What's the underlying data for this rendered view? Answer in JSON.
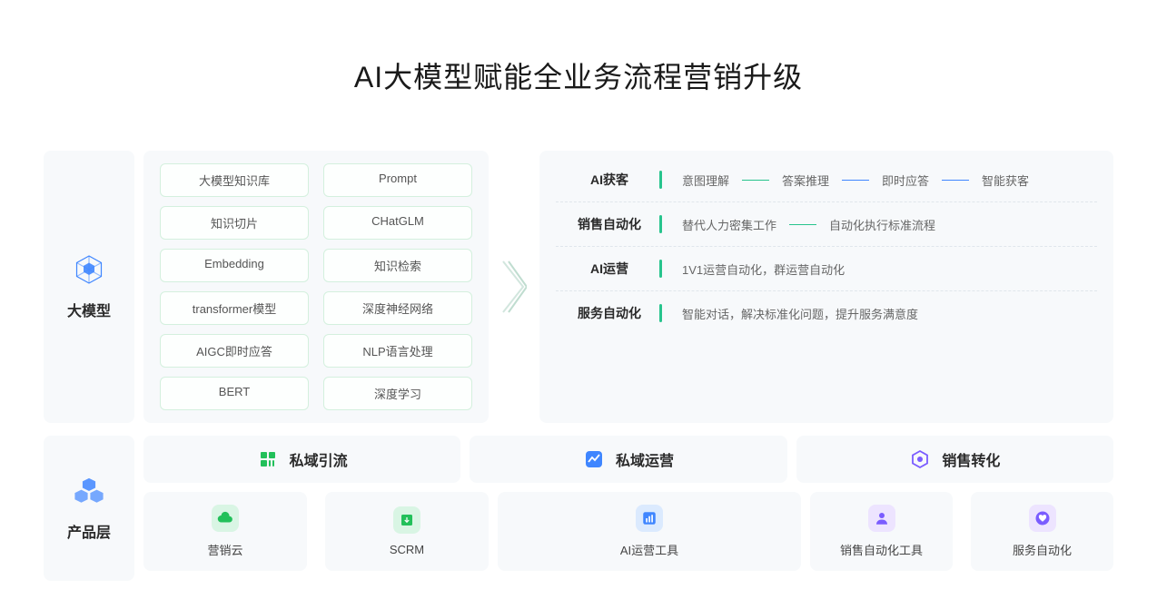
{
  "title": "AI大模型赋能全业务流程营销升级",
  "sidebar": {
    "model": "大模型",
    "product": "产品层"
  },
  "tech_tags": [
    "大模型知识库",
    "Prompt",
    "知识切片",
    "CHatGLM",
    "Embedding",
    "知识检索",
    "transformer模型",
    "深度神经网络",
    "AIGC即时应答",
    "NLP语言处理",
    "BERT",
    "深度学习"
  ],
  "capabilities": [
    {
      "title": "AI获客",
      "items": [
        "意图理解",
        "答案推理",
        "即时应答",
        "智能获客"
      ],
      "lines": [
        "g",
        "b",
        "b"
      ]
    },
    {
      "title": "销售自动化",
      "items": [
        "替代人力密集工作",
        "自动化执行标准流程"
      ],
      "lines": [
        "g"
      ]
    },
    {
      "title": "AI运营",
      "items": [
        "1V1运营自动化，群运营自动化"
      ],
      "lines": []
    },
    {
      "title": "服务自动化",
      "items": [
        "智能对话，解决标准化问题，提升服务满意度"
      ],
      "lines": []
    }
  ],
  "categories": [
    {
      "title": "私域引流",
      "color": "#22c05a"
    },
    {
      "title": "私域运营",
      "color": "#3f86ff"
    },
    {
      "title": "销售转化",
      "color": "#7a5cff"
    }
  ],
  "products": [
    {
      "label": "营销云",
      "bg": "#d9f5e4",
      "fg": "#22c05a",
      "icon": "cloud"
    },
    {
      "label": "SCRM",
      "bg": "#d9f5e4",
      "fg": "#22c05a",
      "icon": "download"
    },
    {
      "label": "AI运营工具",
      "bg": "#dbeafe",
      "fg": "#3f86ff",
      "icon": "chart"
    },
    {
      "label": "销售自动化工具",
      "bg": "#ede4ff",
      "fg": "#7a5cff",
      "icon": "person"
    },
    {
      "label": "服务自动化",
      "bg": "#ede4ff",
      "fg": "#7a5cff",
      "icon": "heart"
    }
  ]
}
